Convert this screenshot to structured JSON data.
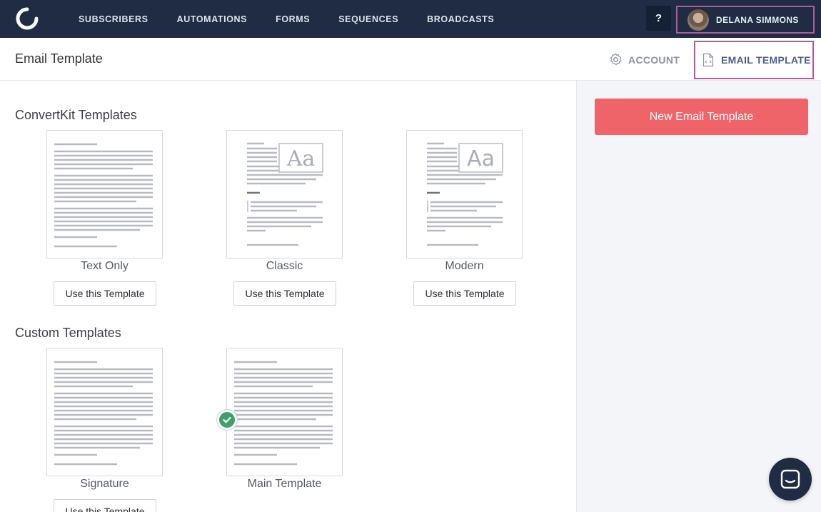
{
  "nav": {
    "items": [
      "SUBSCRIBERS",
      "AUTOMATIONS",
      "FORMS",
      "SEQUENCES",
      "BROADCASTS"
    ],
    "help": "?",
    "user_name": "DELANA SIMMONS"
  },
  "header": {
    "title": "Email Template",
    "tab_account": "ACCOUNT",
    "tab_email_template": "EMAIL TEMPLATE"
  },
  "convertkit_section": {
    "title": "ConvertKit Templates",
    "templates": [
      {
        "label": "Text Only",
        "button": "Use this Template"
      },
      {
        "label": "Classic",
        "button": "Use this Template"
      },
      {
        "label": "Modern",
        "button": "Use this Template"
      }
    ]
  },
  "custom_section": {
    "title": "Custom Templates",
    "templates": [
      {
        "label": "Signature",
        "button": "Use this Template"
      },
      {
        "label": "Main Template",
        "selected": true
      }
    ]
  },
  "sidebar": {
    "new_button": "New Email Template"
  },
  "preview_text": "Aa",
  "colors": {
    "nav_bg": "#1f2c44",
    "accent": "#ee6469",
    "highlight": "#b05aa0",
    "check": "#3fa06a"
  }
}
